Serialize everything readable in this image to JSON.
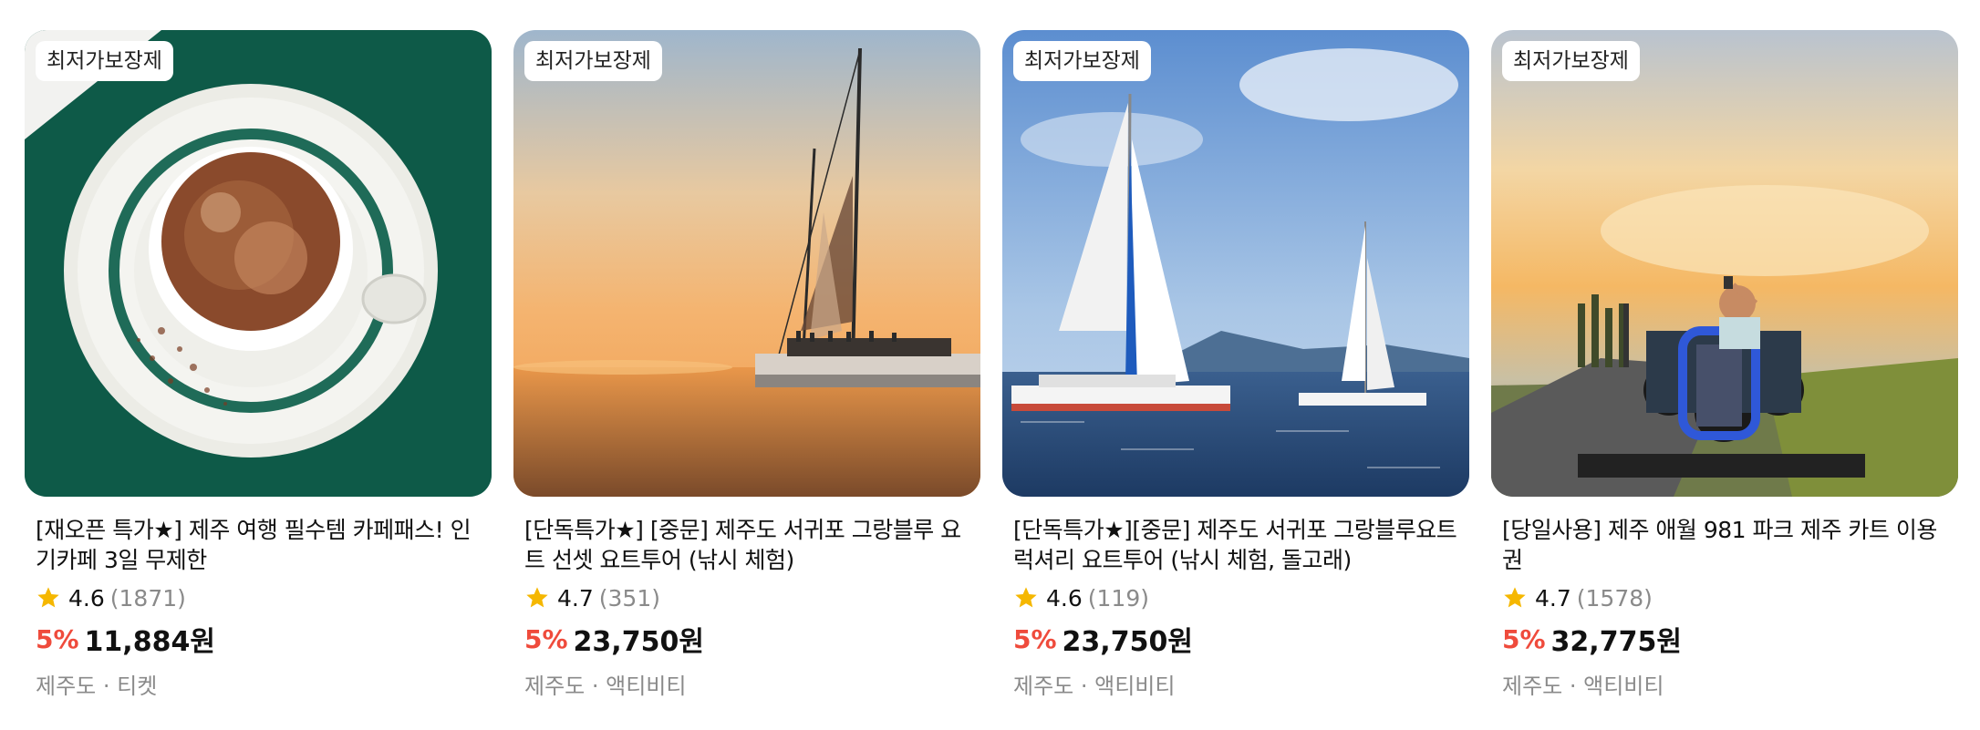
{
  "colors": {
    "discount": "#ef4b3c",
    "star": "#f5b700",
    "muted": "#8a8a8a"
  },
  "products": [
    {
      "badge": "최저가보장제",
      "title": "[재오픈 특가★] 제주 여행 필수템 카페패스! 인기카페 3일 무제한",
      "score": "4.6",
      "count": "(1871)",
      "discount": "5%",
      "price": "11,884원",
      "meta": "제주도 · 티켓",
      "image": "coffee-cup"
    },
    {
      "badge": "최저가보장제",
      "title": "[단독특가★] [중문] 제주도 서귀포 그랑블루 요트 선셋 요트투어 (낚시 체험)",
      "score": "4.7",
      "count": "(351)",
      "discount": "5%",
      "price": "23,750원",
      "meta": "제주도 · 액티비티",
      "image": "sunset-yacht"
    },
    {
      "badge": "최저가보장제",
      "title": "[단독특가★][중문] 제주도 서귀포 그랑블루요트 럭셔리 요트투어 (낚시 체험, 돌고래)",
      "score": "4.6",
      "count": "(119)",
      "discount": "5%",
      "price": "23,750원",
      "meta": "제주도 · 액티비티",
      "image": "catamarans"
    },
    {
      "badge": "최저가보장제",
      "title": "[당일사용] 제주 애월 981 파크 제주 카트 이용권",
      "score": "4.7",
      "count": "(1578)",
      "discount": "5%",
      "price": "32,775원",
      "meta": "제주도 · 액티비티",
      "image": "go-kart"
    }
  ]
}
